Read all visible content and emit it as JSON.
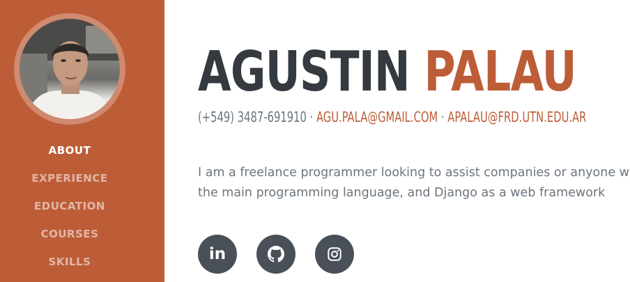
{
  "sidebar": {
    "nav": [
      {
        "label": "ABOUT",
        "active": true
      },
      {
        "label": "EXPERIENCE",
        "active": false
      },
      {
        "label": "EDUCATION",
        "active": false
      },
      {
        "label": "COURSES",
        "active": false
      },
      {
        "label": "SKILLS",
        "active": false
      }
    ],
    "accent_color": "#bd5d38"
  },
  "header": {
    "first_name": "AGUSTIN",
    "last_name": "PALAU"
  },
  "contact": {
    "phone": "(+549) 3487-691910",
    "separator": "·",
    "email_1": "agu.pala@gmail.com",
    "email_2": "apalau@frd.utn.edu.ar"
  },
  "bio": {
    "line_1": "I am a freelance programmer looking to assist companies or anyone who",
    "line_2": "the main programming language, and Django as a web framework"
  },
  "social": [
    {
      "icon": "linkedin-icon",
      "text": "in"
    },
    {
      "icon": "github-icon"
    },
    {
      "icon": "instagram-icon"
    }
  ]
}
